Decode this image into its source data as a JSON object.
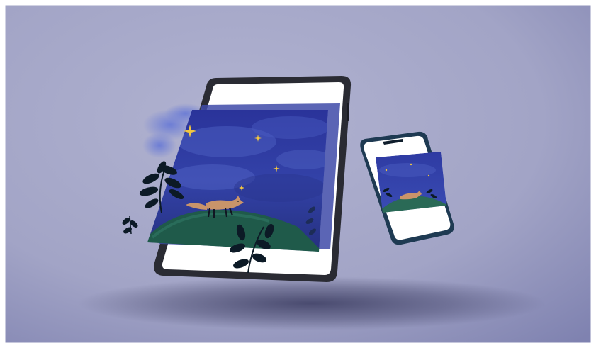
{
  "scene": {
    "background_color": "#a2a4c6",
    "background_edge_color": "#7f82b0",
    "shadow_color": "#2c2d52",
    "ink_color": "#1d1f3a"
  },
  "tablet": {
    "frame_color": "#2a2b33",
    "screen_color": "#ffffff"
  },
  "artwork": {
    "sky_color": "#2f3aa0",
    "sky_deep_color": "#1e2478",
    "cloud_color": "#5a6ccc",
    "hill_color": "#1f5a4a",
    "fox_color": "#c9946a",
    "star_color": "#f2c640",
    "leaf_color": "#0c1a26"
  },
  "phone": {
    "frame_color": "#1e3a52",
    "screen_color": "#ffffff"
  }
}
